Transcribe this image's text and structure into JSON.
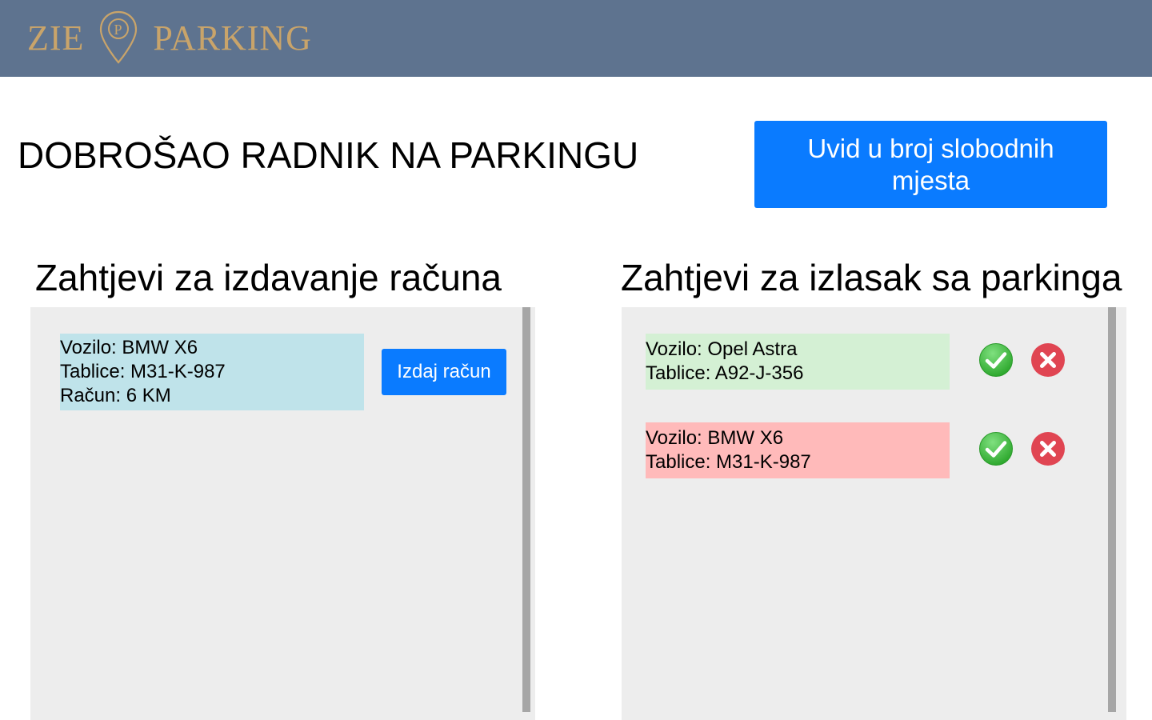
{
  "header": {
    "logo_left": "ZIE",
    "logo_right": "PARKING",
    "logo_pin_letter": "P",
    "background": "#5e738f",
    "logo_color": "#c9a46a"
  },
  "welcome_title": "DOBROŠAO RADNIK NA PARKINGU",
  "free_spots_button": "Uvid u broj slobodnih mjesta",
  "invoice_section": {
    "title": "Zahtjevi za izdavanje računa",
    "requests": [
      {
        "vehicle": "Vozilo: BMW X6",
        "plates": "Tablice: M31-K-987",
        "invoice": "Račun: 6 KM",
        "button_label": "Izdaj račun"
      }
    ]
  },
  "exit_section": {
    "title": "Zahtjevi za izlasak sa parkinga",
    "requests": [
      {
        "vehicle": "Vozilo: Opel Astra",
        "plates": "Tablice: A92-J-356",
        "color": "#d4f0d4",
        "accept_icon": "check-icon",
        "reject_icon": "close-icon"
      },
      {
        "vehicle": "Vozilo: BMW X6",
        "plates": "Tablice: M31-K-987",
        "color": "#ffbaba",
        "accept_icon": "check-icon",
        "reject_icon": "close-icon"
      }
    ]
  },
  "colors": {
    "primary_button": "#0a7bff",
    "panel_bg": "#ededed",
    "invoice_card": "#bfe3ea",
    "accept_green": "#3fbf3f",
    "reject_red": "#e04552"
  }
}
